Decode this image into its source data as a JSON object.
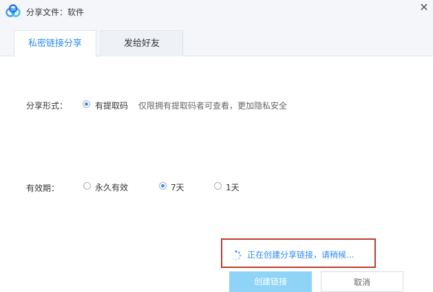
{
  "window": {
    "title": "分享文件：软件",
    "close_icon": "close-icon"
  },
  "tabs": [
    {
      "label": "私密链接分享",
      "active": true
    },
    {
      "label": "发给好友",
      "active": false
    }
  ],
  "share_form": {
    "label": "分享形式：",
    "option": "有提取码",
    "selected": true,
    "hint": "仅限拥有提取码者可查看，更加隐私安全"
  },
  "validity": {
    "label": "有效期：",
    "options": [
      {
        "label": "永久有效",
        "selected": false
      },
      {
        "label": "7天",
        "selected": true
      },
      {
        "label": "1天",
        "selected": false
      }
    ]
  },
  "status": {
    "text": "正在创建分享链接，请稍候...",
    "icon": "spinner-icon"
  },
  "buttons": {
    "create": "创建链接",
    "cancel": "取消"
  },
  "colors": {
    "accent": "#2d8cf0",
    "create_button_bg": "#8fd3f6",
    "highlight_border": "#c0392b"
  }
}
